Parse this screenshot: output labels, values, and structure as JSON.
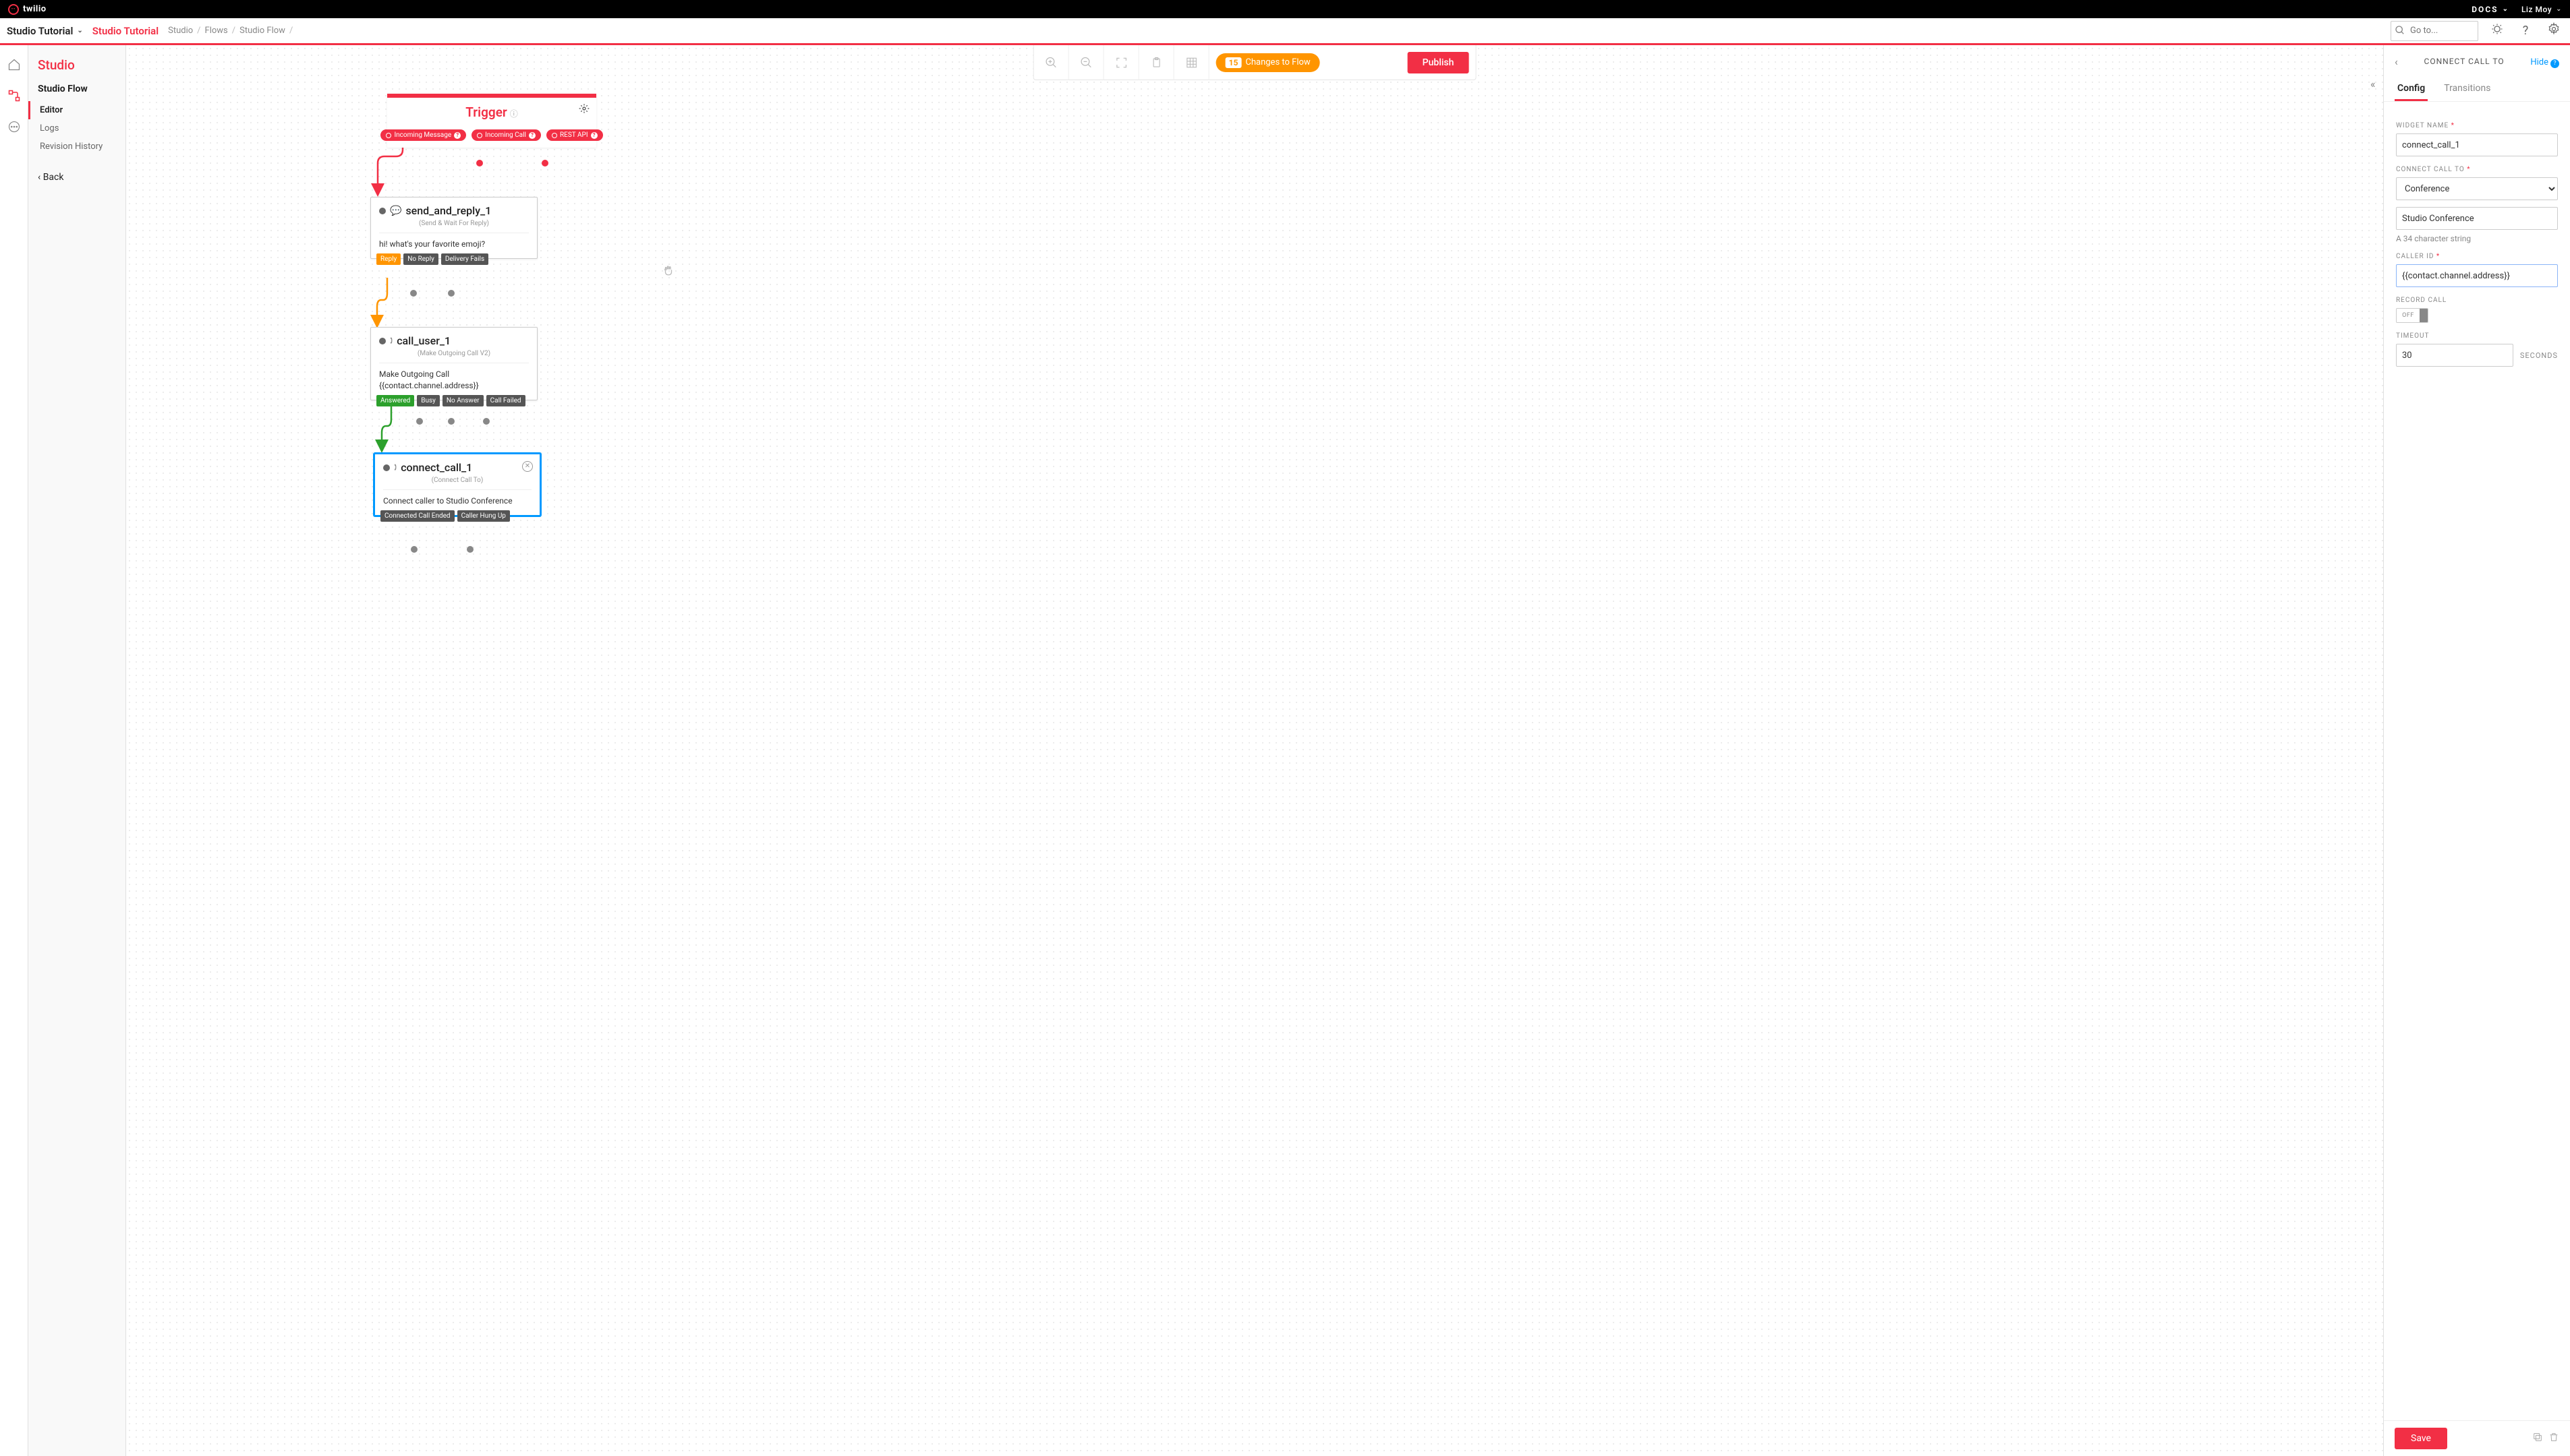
{
  "topbar": {
    "brand": "twilio",
    "docs": "DOCS",
    "user": "Liz Moy"
  },
  "subbar": {
    "project": "Studio Tutorial",
    "project_highlight": "Studio Tutorial",
    "crumb1": "Studio",
    "crumb2": "Flows",
    "crumb3": "Studio Flow",
    "search_placeholder": "Go to..."
  },
  "sidepanel": {
    "title": "Studio",
    "flowname": "Studio Flow",
    "nav_editor": "Editor",
    "nav_logs": "Logs",
    "nav_revhist": "Revision History",
    "back": "Back"
  },
  "toolbar": {
    "changes_count": "15",
    "changes_label": "Changes to Flow",
    "publish": "Publish"
  },
  "trigger": {
    "name": "Trigger",
    "outlet_msg": "Incoming Message",
    "outlet_call": "Incoming Call",
    "outlet_rest": "REST API"
  },
  "w1": {
    "name": "send_and_reply_1",
    "sub": "(Send & Wait For Reply)",
    "body": "hi! what's your favorite emoji?",
    "out_reply": "Reply",
    "out_noreply": "No Reply",
    "out_delfail": "Delivery Fails"
  },
  "w2": {
    "name": "call_user_1",
    "sub": "(Make Outgoing Call V2)",
    "body_l1": "Make Outgoing Call",
    "body_l2": "{{contact.channel.address}}",
    "out_ans": "Answered",
    "out_busy": "Busy",
    "out_noans": "No Answer",
    "out_fail": "Call Failed"
  },
  "w3": {
    "name": "connect_call_1",
    "sub": "(Connect Call To)",
    "body": "Connect caller to Studio Conference",
    "out_ended": "Connected Call Ended",
    "out_hung": "Caller Hung Up"
  },
  "config": {
    "title": "CONNECT CALL TO",
    "hide": "Hide",
    "tab_config": "Config",
    "tab_trans": "Transitions",
    "label_widgetname": "WIDGET NAME",
    "val_widgetname": "connect_call_1",
    "label_connectto": "CONNECT CALL TO",
    "val_connectto": "Conference",
    "val_confname": "Studio Conference",
    "hint_conf": "A 34 character string",
    "label_callerid": "CALLER ID",
    "val_callerid": "{{contact.channel.address}}",
    "label_record": "RECORD CALL",
    "toggle_off": "OFF",
    "label_timeout": "TIMEOUT",
    "val_timeout": "30",
    "seconds": "SECONDS",
    "save": "Save"
  }
}
